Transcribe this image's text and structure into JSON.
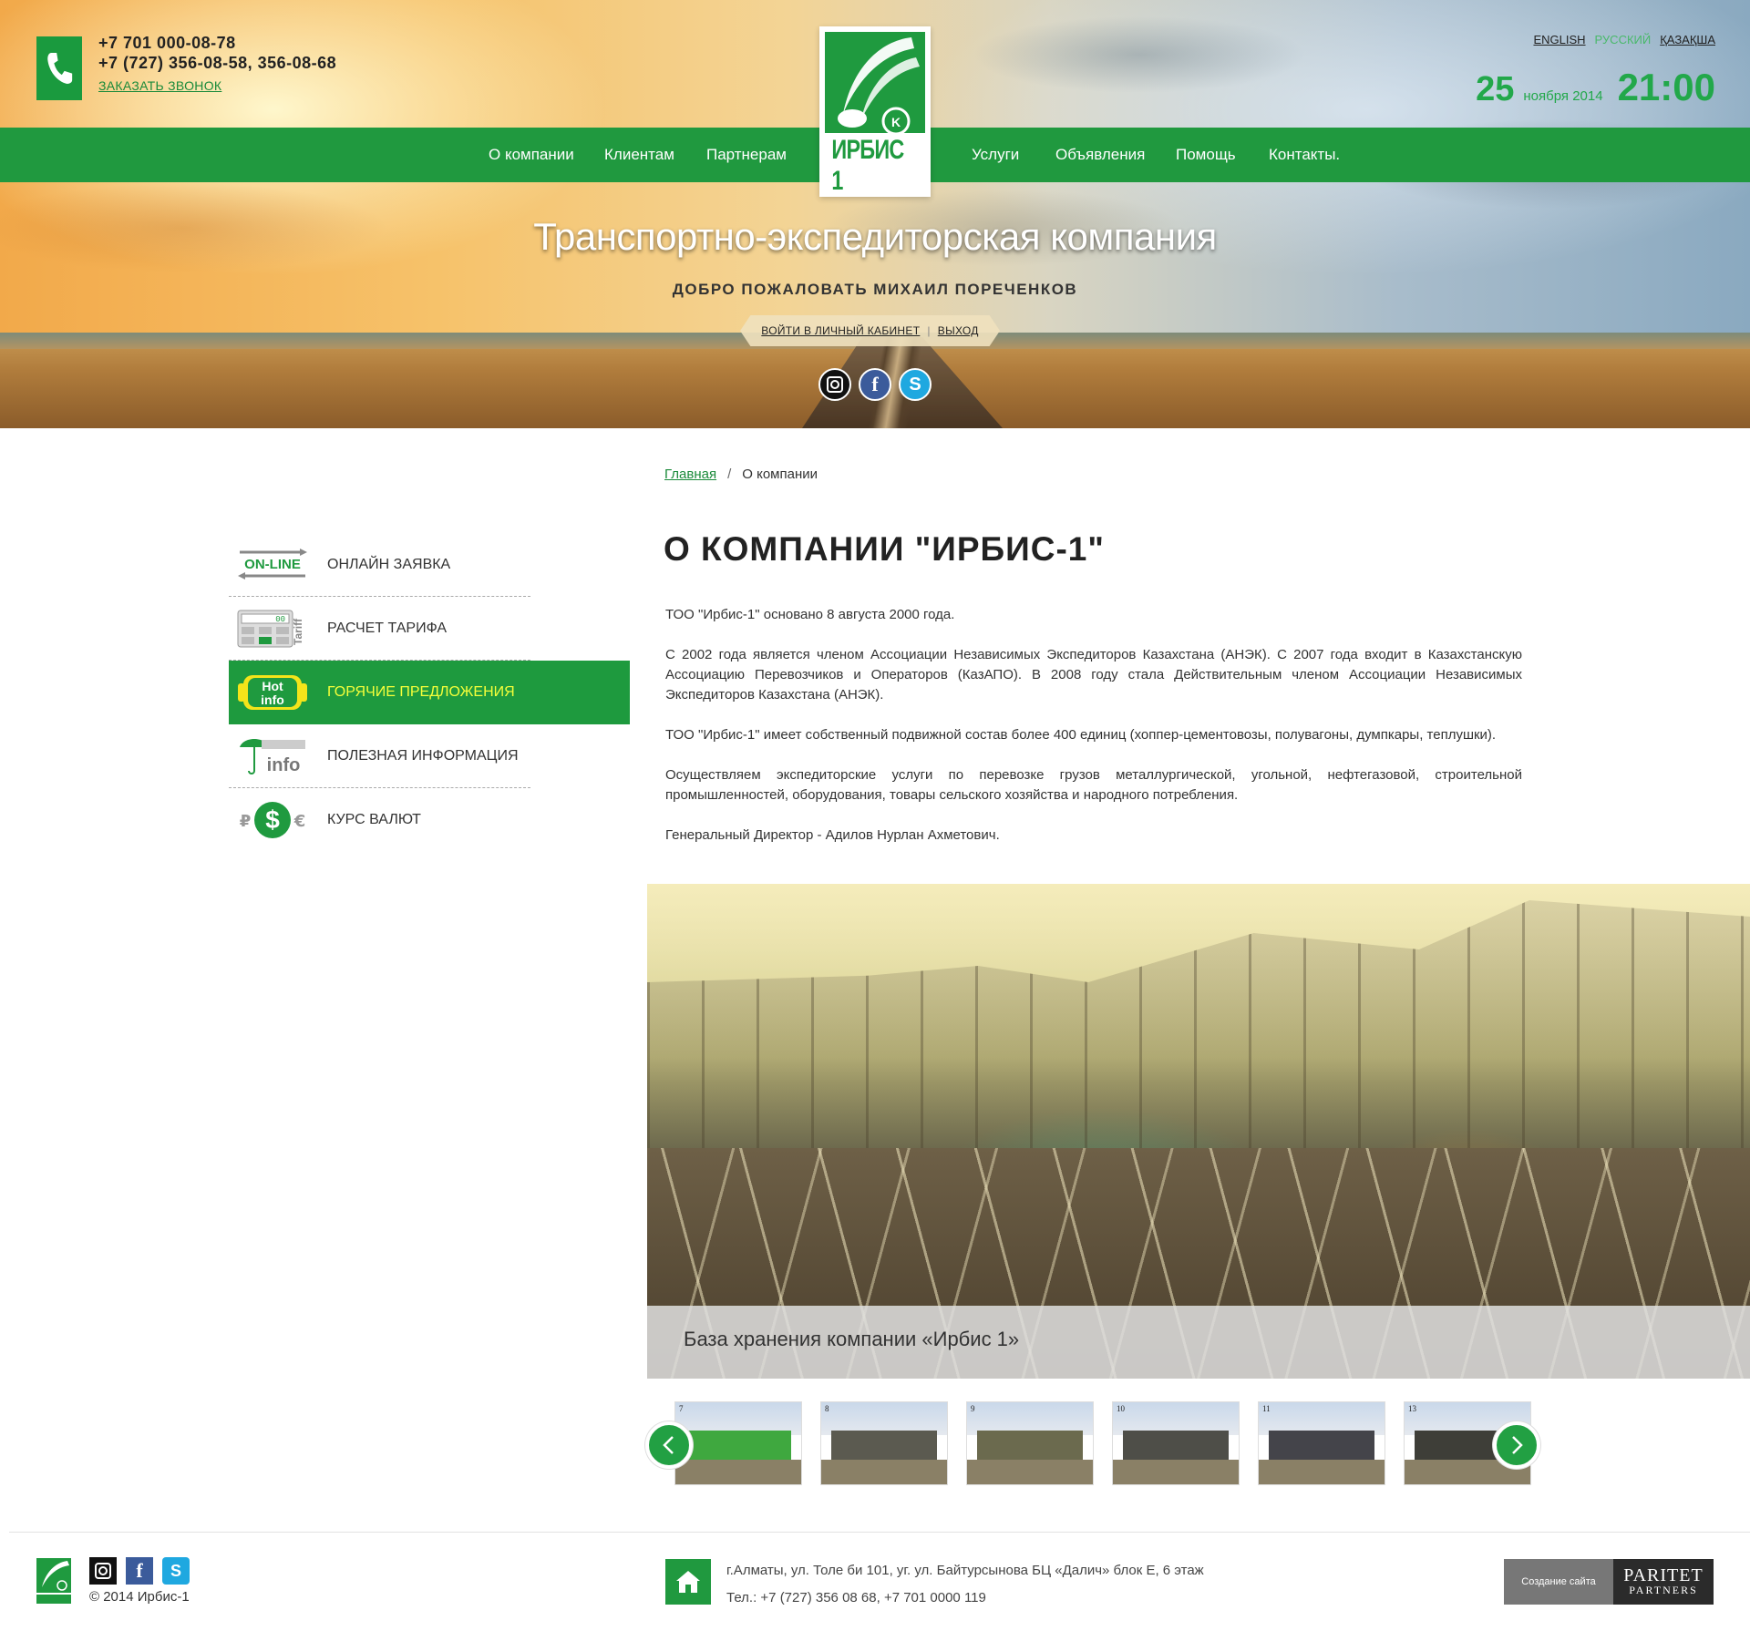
{
  "header": {
    "phones": [
      "+7 701 000-08-78",
      "+7 (727) 356-08-58, 356-08-68"
    ],
    "call_link": "ЗАКАЗАТЬ ЗВОНОК",
    "languages": [
      {
        "label": "ENGLISH",
        "active": false
      },
      {
        "label": "РУССКИЙ",
        "active": true
      },
      {
        "label": "ҚАЗАҚША",
        "active": false
      }
    ],
    "date": {
      "day": "25",
      "month_year": "ноября 2014",
      "time": "21:00"
    },
    "logo_text": "ИРБИС 1",
    "nav": [
      "О компании",
      "Клиентам",
      "Партнерам",
      "Услуги",
      "Объявления",
      "Помощь",
      "Контакты."
    ],
    "tagline": "Транспортно-экспедиторская компания",
    "welcome": "ДОБРО ПОЖАЛОВАТЬ МИХАИЛ ПОРЕЧЕНКОВ",
    "cabinet_link": "ВОЙТИ В ЛИЧНЫЙ КАБИНЕТ",
    "cabinet_sep": "|",
    "logout_link": "ВЫХОД",
    "social": [
      "instagram-icon",
      "facebook-icon",
      "skype-icon"
    ]
  },
  "breadcrumb": {
    "home": "Главная",
    "separator": "/",
    "current": "О компании"
  },
  "sidebar": {
    "items": [
      {
        "label": "ОНЛАЙН ЗАЯВКА",
        "icon": "online-icon",
        "icon_text": "ON-LINE",
        "active": false
      },
      {
        "label": "РАСЧЕТ ТАРИФА",
        "icon": "calculator-icon",
        "icon_text": "Tariff",
        "active": false
      },
      {
        "label": "ГОРЯЧИЕ ПРЕДЛОЖЕНИЯ",
        "icon": "hot-info-icon",
        "icon_text": "Hot info",
        "active": true
      },
      {
        "label": "ПОЛЕЗНАЯ ИНФОРМАЦИЯ",
        "icon": "umbrella-info-icon",
        "icon_text": "info",
        "active": false
      },
      {
        "label": "КУРС ВАЛЮТ",
        "icon": "currency-icon",
        "icon_text": "₽ $ €",
        "active": false
      }
    ]
  },
  "main": {
    "title": "О КОМПАНИИ \"ИРБИС-1\"",
    "paragraphs": [
      "ТОО \"Ирбис-1\" основано 8 августа 2000 года.",
      "С 2002 года является членом Ассоциации Независимых Экспедиторов Казахстана (АНЭК). С 2007 года входит в Казахстанскую Ассоциацию Перевозчиков и Операторов (КазАПО). В 2008 году стала Действительным членом Ассоциации Независимых Экспедиторов Казахстана (АНЭК).",
      "ТОО \"Ирбис-1\" имеет собственный подвижной состав более 400 единиц (хоппер-цементовозы, полувагоны, думпкары, теплушки).",
      "Осуществляем экспедиторские услуги по перевозке грузов металлургической, угольной, нефтегазовой, строительной промышленностей, оборудования, товары сельского хозяйства и народного потребления.",
      "Генеральный Директор - Адилов Нурлан Ахметович."
    ],
    "gallery": {
      "caption": "База хранения компании «Ирбис 1»",
      "thumb_numbers": [
        "7",
        "8",
        "9",
        "10",
        "11",
        "13"
      ]
    }
  },
  "footer": {
    "copyright": "© 2014  Ирбис-1",
    "address": "г.Алматы, ул. Толе би 101, уг. ул. Байтурсынова БЦ «Далич» блок Е, 6 этаж",
    "phones": "Тел.: +7 (727) 356 08 68, +7 701 0000 119",
    "dev_label": "Создание сайта",
    "dev_brand_top": "PARITET",
    "dev_brand_bottom": "PARTNERS"
  },
  "colors": {
    "brand_green": "#20993f",
    "active_label": "#f5ff3a",
    "link_green": "#1a8a3a"
  }
}
